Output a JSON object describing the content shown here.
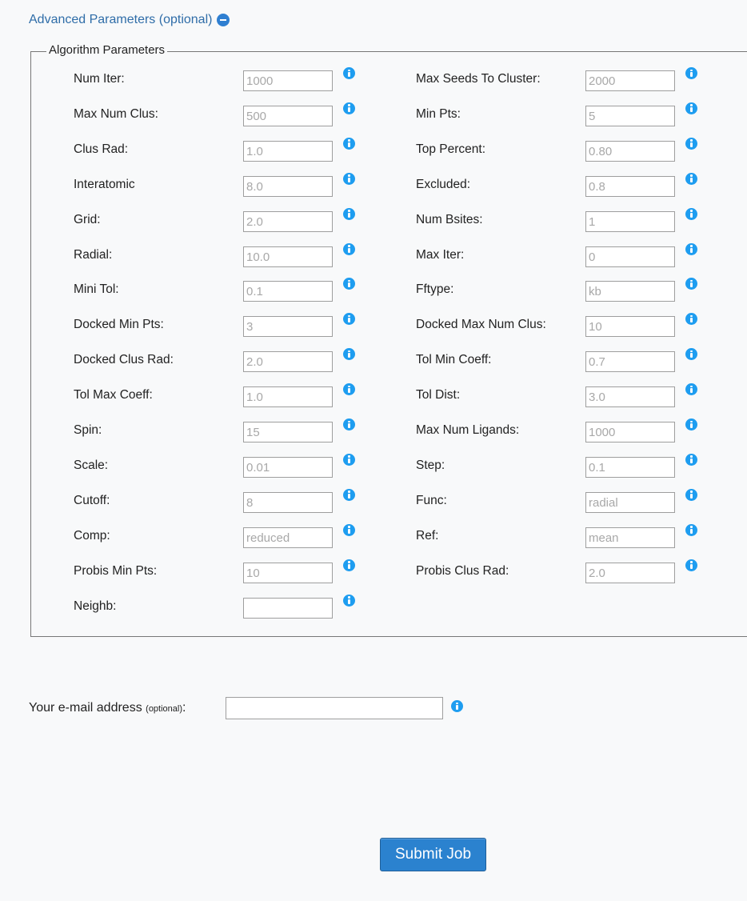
{
  "advanced": {
    "title": "Advanced Parameters (optional)"
  },
  "algorithm": {
    "legend": "Algorithm Parameters",
    "left": [
      {
        "label": "Num Iter:",
        "value": "1000"
      },
      {
        "label": "Max Num Clus:",
        "value": "500"
      },
      {
        "label": "Clus Rad:",
        "value": "1.0"
      },
      {
        "label": "Interatomic",
        "value": "8.0"
      },
      {
        "label": "Grid:",
        "value": "2.0"
      },
      {
        "label": "Radial:",
        "value": "10.0"
      },
      {
        "label": "Mini Tol:",
        "value": "0.1"
      },
      {
        "label": "Docked Min Pts:",
        "value": "3"
      },
      {
        "label": "Docked Clus Rad:",
        "value": "2.0"
      },
      {
        "label": "Tol Max Coeff:",
        "value": "1.0"
      },
      {
        "label": "Spin:",
        "value": "15"
      },
      {
        "label": "Scale:",
        "value": "0.01"
      },
      {
        "label": "Cutoff:",
        "value": "8"
      },
      {
        "label": "Comp:",
        "value": "reduced"
      },
      {
        "label": "Probis Min Pts:",
        "value": "10"
      },
      {
        "label": "Neighb:",
        "value": ""
      }
    ],
    "right": [
      {
        "label": "Max Seeds To Cluster:",
        "value": "2000"
      },
      {
        "label": "Min Pts:",
        "value": "5"
      },
      {
        "label": "Top Percent:",
        "value": "0.80"
      },
      {
        "label": "Excluded:",
        "value": "0.8"
      },
      {
        "label": "Num Bsites:",
        "value": "1"
      },
      {
        "label": "Max Iter:",
        "value": "0"
      },
      {
        "label": "Fftype:",
        "value": "kb"
      },
      {
        "label": "Docked Max Num Clus:",
        "value": "10"
      },
      {
        "label": "Tol Min Coeff:",
        "value": "0.7"
      },
      {
        "label": "Tol Dist:",
        "value": "3.0"
      },
      {
        "label": "Max Num Ligands:",
        "value": "1000"
      },
      {
        "label": "Step:",
        "value": "0.1"
      },
      {
        "label": "Func:",
        "value": "radial"
      },
      {
        "label": "Ref:",
        "value": "mean"
      },
      {
        "label": "Probis Clus Rad:",
        "value": "2.0"
      }
    ]
  },
  "email": {
    "label": "Your e-mail address",
    "optional": "(optional)",
    "colon": ":",
    "value": ""
  },
  "submit": {
    "label": "Submit Job"
  },
  "icons": {
    "info": "info-icon",
    "collapse": "minus-circle-icon"
  },
  "colors": {
    "link": "#2f6da8",
    "info": "#1e9df0",
    "button": "#2b82cf"
  }
}
